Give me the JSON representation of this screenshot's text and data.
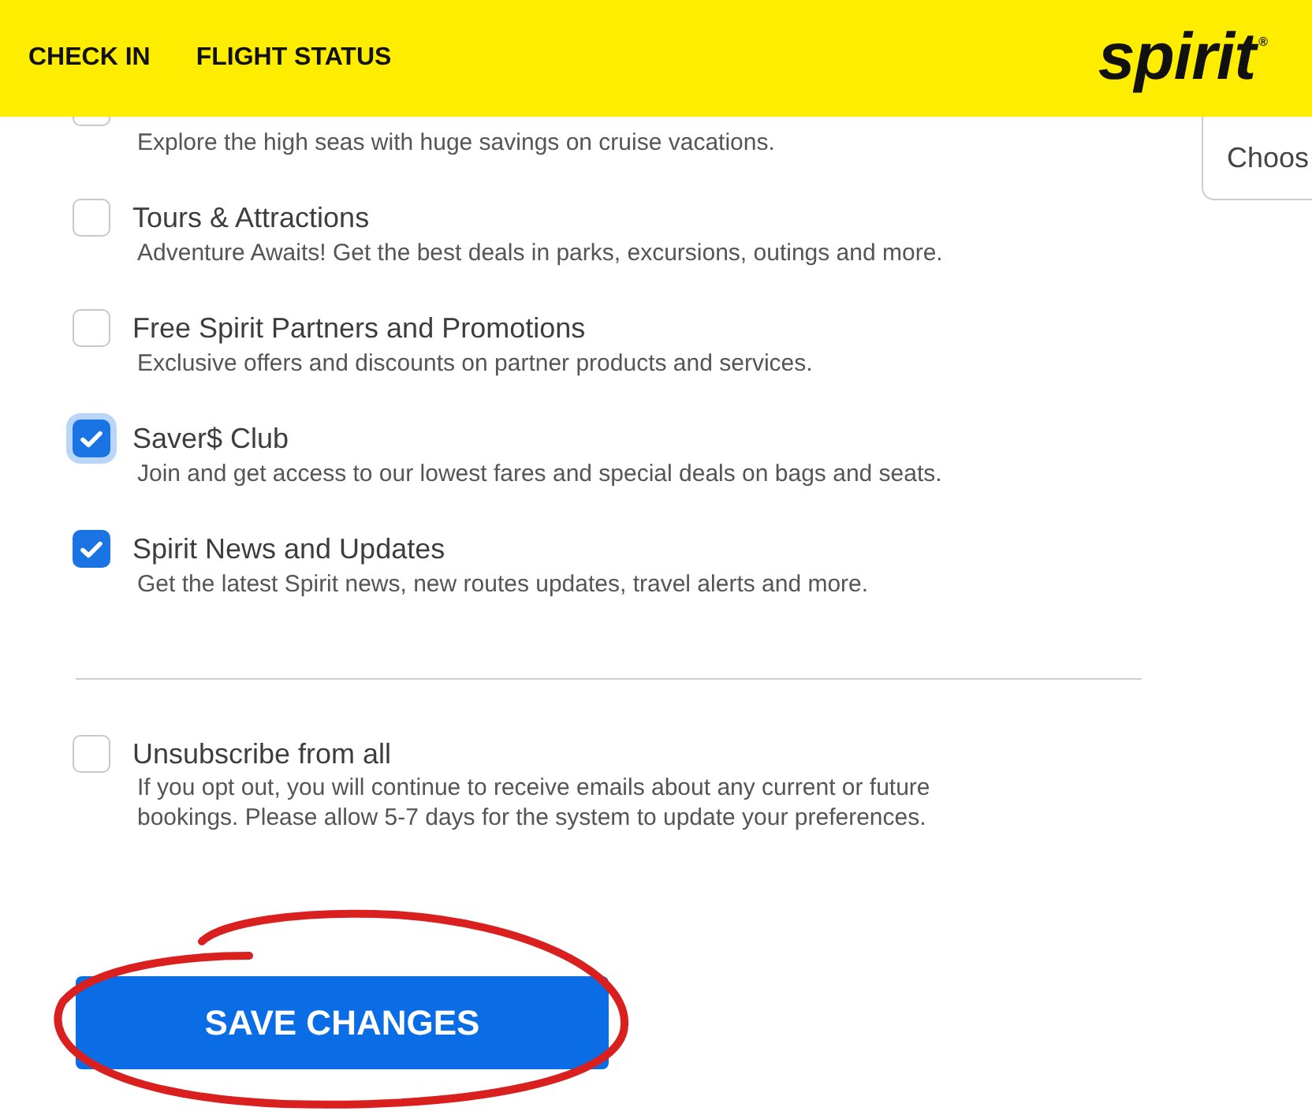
{
  "header": {
    "nav": [
      "CHECK IN",
      "FLIGHT STATUS"
    ],
    "logo": "spirit$^{®}$"
  },
  "dropdown": {
    "value": "Choos"
  },
  "preferences": [
    {
      "description": "Explore the high seas with huge savings on cruise vacations.",
      "checked": false,
      "focused": false
    },
    {
      "title": "Tours & Attractions",
      "description": "Adventure Awaits! Get the best deals in parks, excursions, outings and more.",
      "checked": false,
      "focused": false
    },
    {
      "title": "Free Spirit Partners and Promotions",
      "description": "Exclusive offers and discounts on partner products and services.",
      "checked": false,
      "focused": false
    },
    {
      "title": "Saver$ Club",
      "description": "Join and get access to our lowest fares and special deals on bags and seats.",
      "checked": true,
      "focused": true
    },
    {
      "title": "Spirit News and Updates",
      "description": "Get the latest Spirit news, new routes updates, travel alerts and more.",
      "checked": true,
      "focused": false
    }
  ],
  "unsubscribe": {
    "title": "Unsubscribe from all",
    "description": "If you opt out, you will continue to receive emails about any current or future bookings. Please allow 5-7 days for the system to update your preferences.",
    "checked": false,
    "focused": false
  },
  "save_button": {
    "label": "SAVE CHANGES",
    "circled": true
  }
}
